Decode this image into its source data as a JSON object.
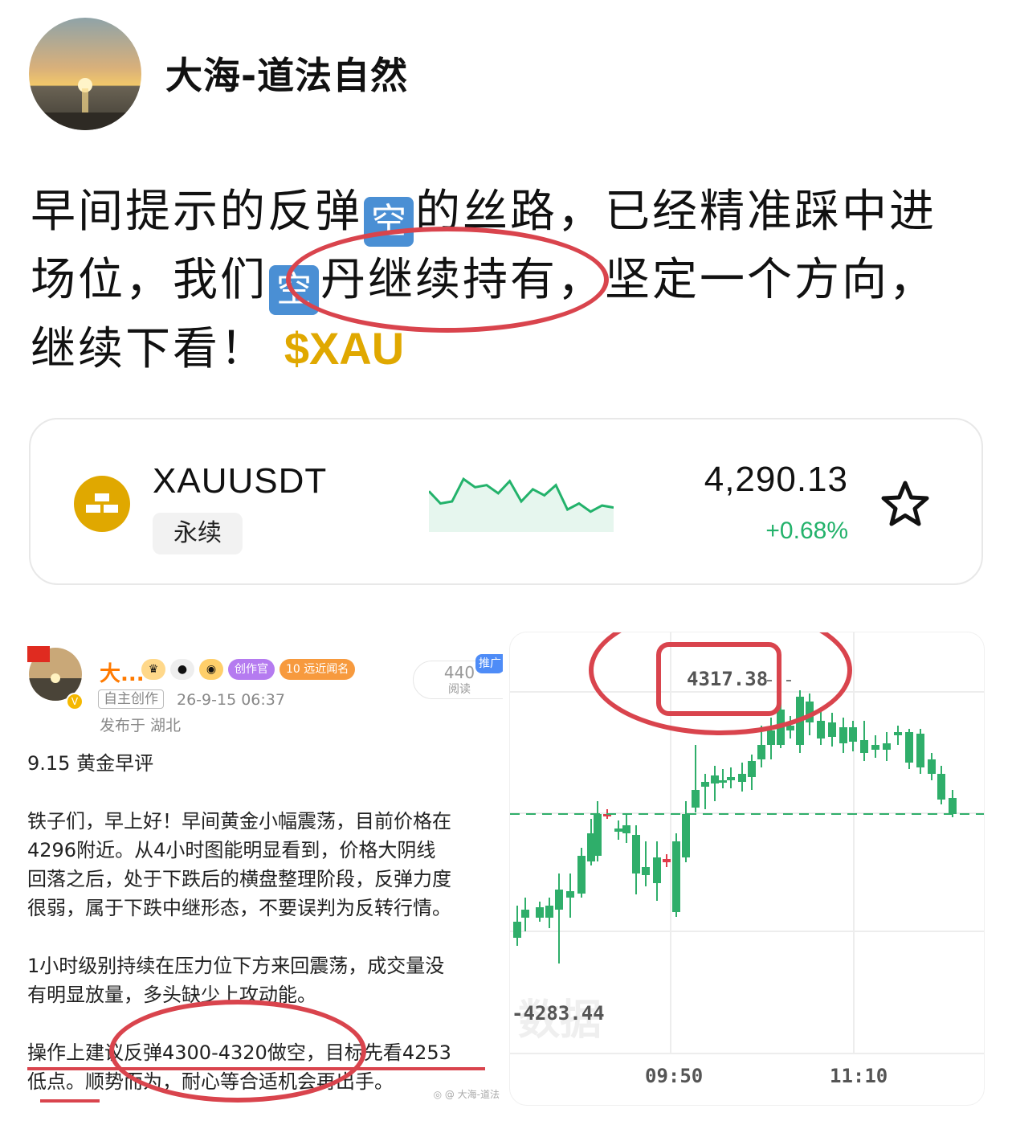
{
  "author": {
    "name": "大海-道法自然"
  },
  "post": {
    "line1_a": "早间提示的反弹",
    "line1_b": "的丝路，已经精准踩中进",
    "line2_a": "场位，我们",
    "line2_b": "丹继续持有，坚定一个方向，",
    "line3": "继续下看！",
    "emoji_char": "空",
    "ticker_tag": "$XAU"
  },
  "ticker_card": {
    "symbol": "XAUUSDT",
    "type_label": "永续",
    "price": "4,290.13",
    "change": "+0.68%",
    "icon": "gold-bars-icon",
    "favorite_icon": "star-outline-icon",
    "accent": "#e0a800",
    "change_color": "#23b26b",
    "sparkline": [
      40,
      28,
      30,
      52,
      44,
      46,
      38,
      50,
      30,
      42,
      36,
      46,
      22,
      28,
      20,
      26,
      24
    ]
  },
  "left_shot": {
    "author_short": "大...",
    "badge_creator": "创作官",
    "badge_fame": "远近闻名",
    "badge_level": "10",
    "read_count": "440",
    "read_label": "阅读",
    "promo": "推广",
    "tag": "自主创作",
    "time": "26-9-15 06:37",
    "location": "发布于 湖北",
    "title": "9.15  黄金早评",
    "p1": [
      "铁子们，早上好！早间黄金小幅震荡，目前价格在",
      "4296附近。从4小时图能明显看到，价格大阴线",
      "回落之后，处于下跌后的横盘整理阶段，反弹力度",
      "很弱，属于下跌中继形态，不要误判为反转行情。"
    ],
    "p2": [
      "1小时级别持续在压力位下方来回震荡，成交量没",
      "有明显放量，多头缺少上攻动能。"
    ],
    "p3": [
      "操作上建议反弹4300-4320做空，目标先看4253",
      "低点。顺势而为，耐心等合适机会再出手。"
    ],
    "watermark": "◎ @ 大海-道法"
  },
  "right_chart": {
    "high_label": "4317.38",
    "low_label": "-4283.44",
    "time_labels": [
      "09:50",
      "11:10"
    ],
    "watermark": "数据",
    "up_color": "#e03c4a",
    "down_color": "#2fae6a",
    "chart_data": {
      "type": "candlestick",
      "high": 4317.38,
      "low": 4283.44,
      "x_ticks": [
        "09:50",
        "11:10"
      ],
      "reference_line": "dashed-green"
    }
  }
}
